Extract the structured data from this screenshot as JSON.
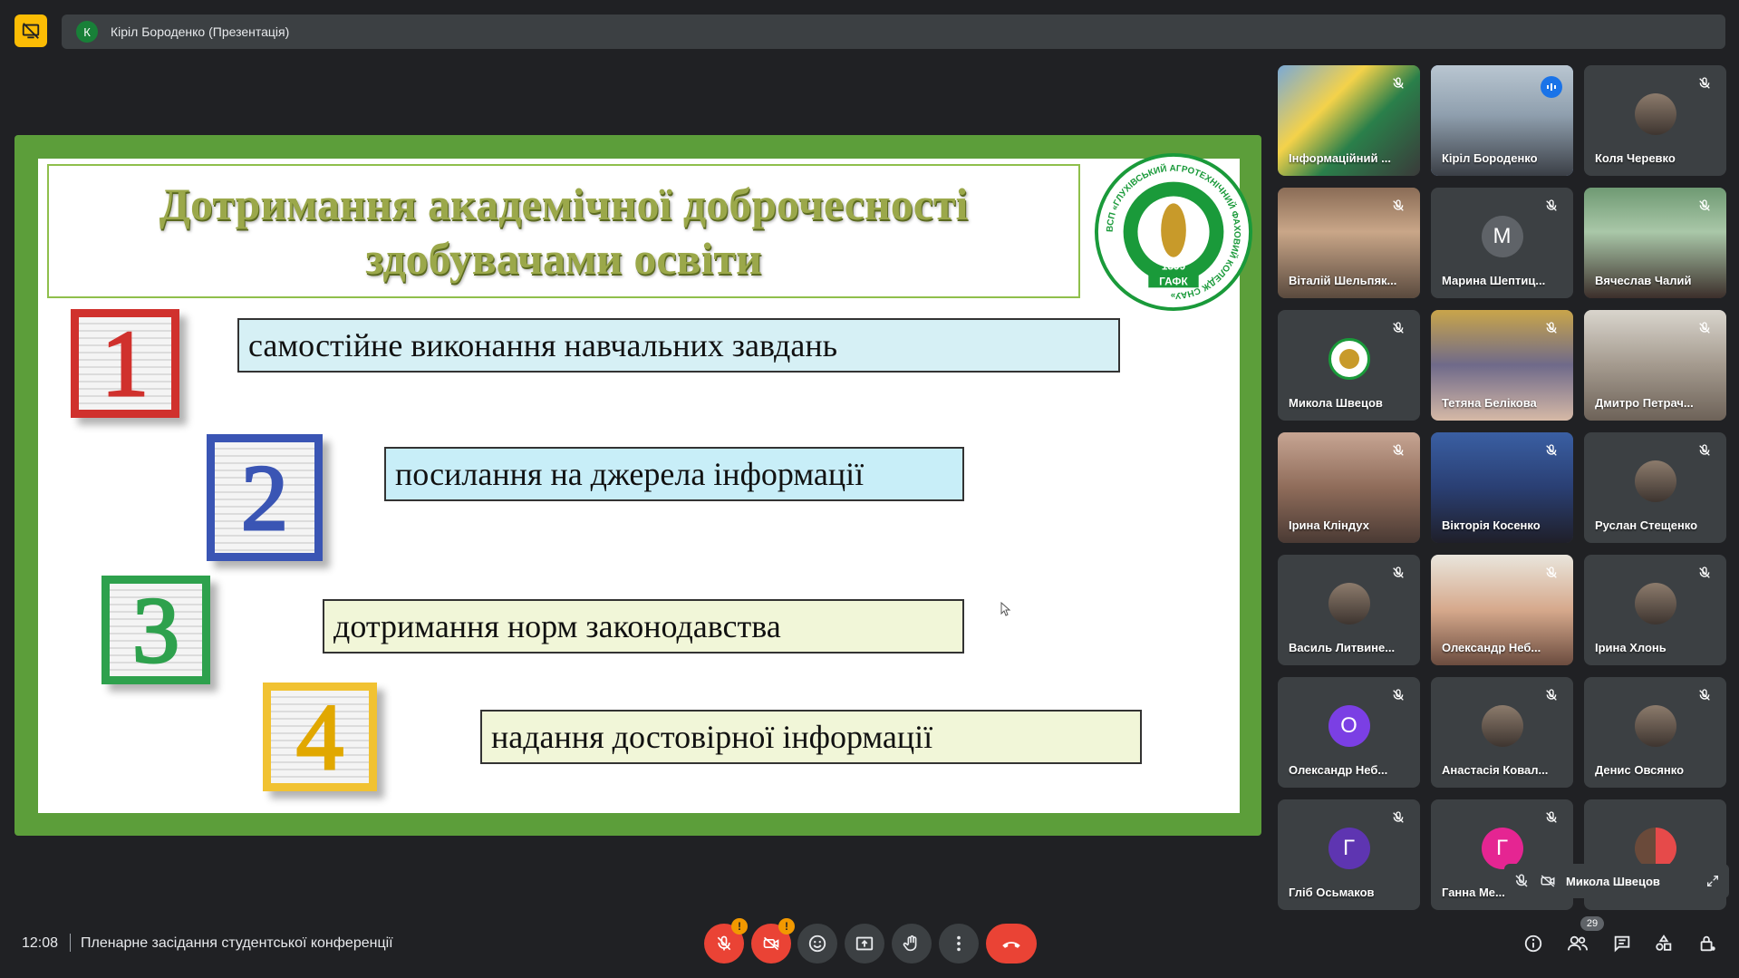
{
  "topbar": {
    "presenter_initial": "К",
    "presenter_title": "Кіріл Бороденко (Презентація)",
    "present_icon": "stop-presenting-icon",
    "accent": "#fbbc04"
  },
  "slide": {
    "title": "Дотримання академічної доброчесності\nздобувачами освіти",
    "logo_ring_text": "ВСП «ГЛУХІВСЬКИЙ АГРОТЕХНІЧНИЙ ФАХОВИЙ КОЛЕДЖ СНАУ»",
    "logo_year": "1899",
    "logo_abbr": "ГАФК",
    "cubes": [
      "1",
      "2",
      "3",
      "4"
    ],
    "items": [
      "самостійне виконання навчальних завдань",
      "посилання на джерела інформації",
      "дотримання норм законодавства",
      "надання достовірної інформації"
    ],
    "frame_color": "#5c9e3a"
  },
  "participants": [
    {
      "name": "Інформаційний ...",
      "type": "photo"
    },
    {
      "name": "Кіріл Бороденко",
      "type": "photo",
      "speaking": true
    },
    {
      "name": "Коля Черевко",
      "type": "avatar"
    },
    {
      "name": "Віталій Шельпяк...",
      "type": "photo"
    },
    {
      "name": "Марина Шептиц...",
      "type": "letter",
      "letter": "М",
      "color": "#5f6368"
    },
    {
      "name": "Вячеслав Чалий",
      "type": "photo"
    },
    {
      "name": "Микола Швецов",
      "type": "logo"
    },
    {
      "name": "Тетяна Белікова",
      "type": "photo"
    },
    {
      "name": "Дмитро Петрач...",
      "type": "photo"
    },
    {
      "name": "Ірина Кліндух",
      "type": "photo"
    },
    {
      "name": "Вікторія Косенко",
      "type": "photo"
    },
    {
      "name": "Руслан Стещенко",
      "type": "avatar"
    },
    {
      "name": "Василь Литвине...",
      "type": "avatar"
    },
    {
      "name": "Олександр Неб...",
      "type": "photo"
    },
    {
      "name": "Ірина Хлонь",
      "type": "avatar"
    },
    {
      "name": "Олександр Неб...",
      "type": "letter",
      "letter": "О",
      "color": "#7b3fe4"
    },
    {
      "name": "Анастасія Ковал...",
      "type": "avatar"
    },
    {
      "name": "Денис Овсянко",
      "type": "avatar"
    },
    {
      "name": "Гліб Осьмаков",
      "type": "letter",
      "letter": "Г",
      "color": "#5e35b1"
    },
    {
      "name": "Ганна Ме...",
      "type": "letter",
      "letter": "Г",
      "color": "#e52592"
    },
    {
      "name": "",
      "type": "group"
    }
  ],
  "self_view": {
    "name": "Микола Швецов"
  },
  "bottom": {
    "time": "12:08",
    "meeting_title": "Пленарне засідання студентської конференції",
    "participant_count": "29",
    "warning_mark": "!"
  }
}
